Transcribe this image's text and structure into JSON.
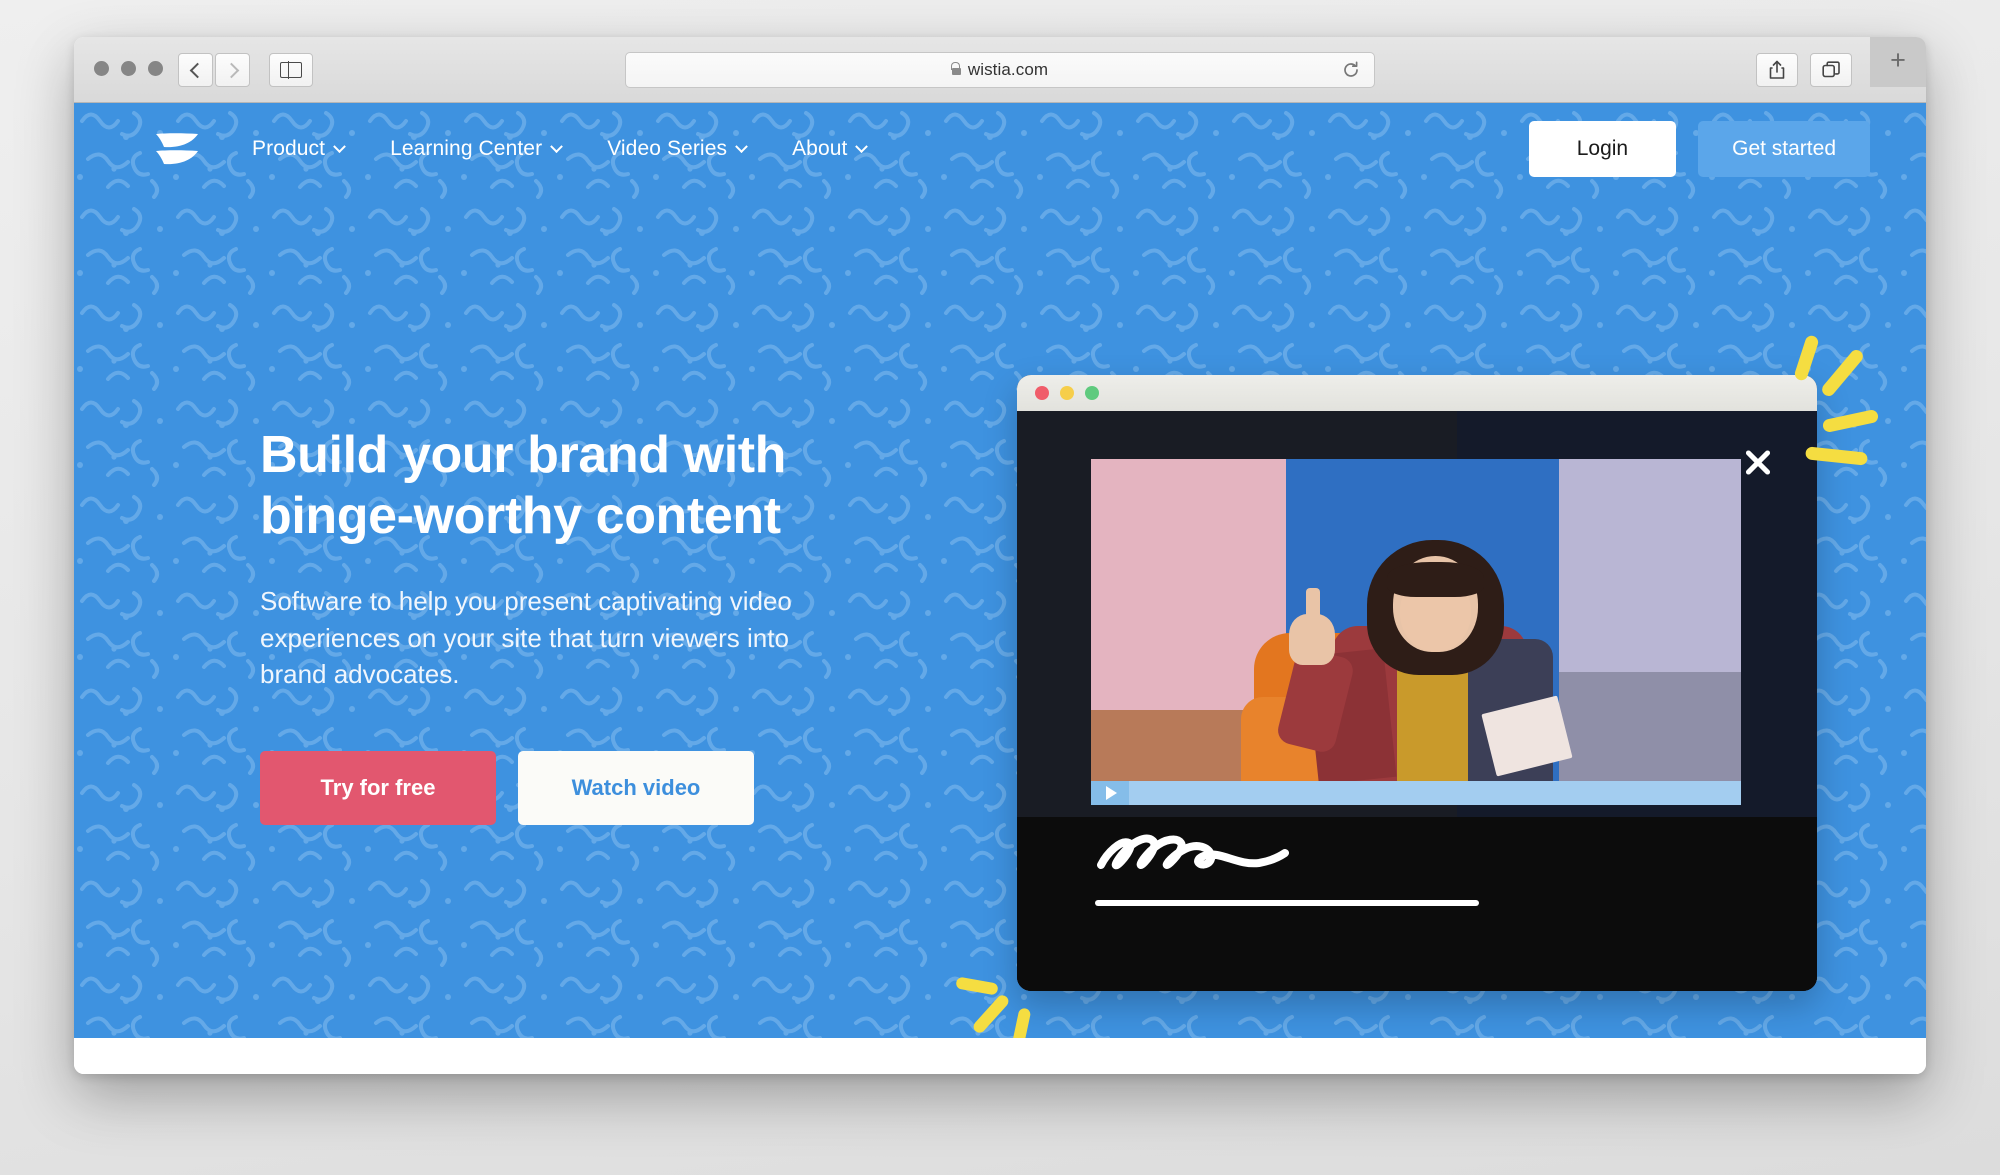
{
  "browser": {
    "url": "wistia.com",
    "lock_icon": "lock-icon",
    "back_icon": "chevron-left-icon",
    "forward_icon": "chevron-right-icon",
    "sidebar_icon": "sidebar-toggle-icon",
    "reload_icon": "reload-icon",
    "share_icon": "share-icon",
    "tabs_icon": "show-tabs-icon",
    "new_tab_icon": "plus-icon",
    "new_tab_label": "+"
  },
  "site": {
    "logo_name": "wistia-logo",
    "nav": [
      {
        "label": "Product",
        "caret": true
      },
      {
        "label": "Learning Center",
        "caret": true
      },
      {
        "label": "Video Series",
        "caret": true
      },
      {
        "label": "About",
        "caret": true
      }
    ],
    "login_label": "Login",
    "get_started_label": "Get started"
  },
  "hero": {
    "title": "Build your brand with binge-worthy content",
    "subtitle": "Software to help you present captivating video experiences on your site that turn viewers into brand advocates.",
    "primary_cta": "Try for free",
    "secondary_cta": "Watch video",
    "background_color": "#3e92e0",
    "primary_cta_color": "#e2576f",
    "secondary_cta_text_color": "#3d8fdd"
  },
  "video_mockup": {
    "window_dots": [
      "#f05d6a",
      "#f6ce4a",
      "#5fca7e"
    ],
    "close_icon": "close-icon",
    "play_icon": "play-icon",
    "signature_text": "ellen",
    "accent_color": "#f5dd41",
    "player_bar_color": "#a3cdf0"
  }
}
